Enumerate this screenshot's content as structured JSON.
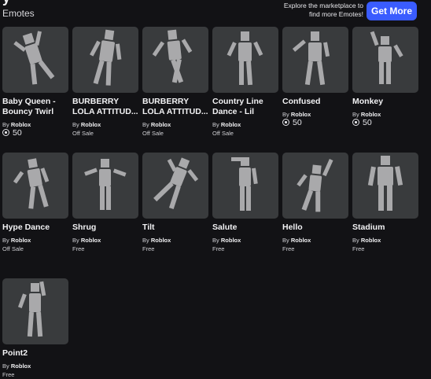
{
  "header": {
    "section_title": "Emotes",
    "promo_text_line1": "Explore the marketplace to",
    "promo_text_line2": "find more Emotes!",
    "get_more_label": "Get More"
  },
  "colors": {
    "accent": "#3a5cff",
    "card_bg": "#393b3d",
    "page_bg": "#121215"
  },
  "emotes": [
    {
      "name_line1": "Baby Queen -",
      "name_line2": "Bouncy Twirl",
      "by": "By",
      "creator": "Roblox",
      "price": "50",
      "price_type": "robux",
      "icon": "robux-icon"
    },
    {
      "name_line1": "BURBERRY",
      "name_line2": "LOLA ATTITUD...",
      "by": "By",
      "creator": "Roblox",
      "price": "Off Sale",
      "price_type": "text"
    },
    {
      "name_line1": "BURBERRY",
      "name_line2": "LOLA ATTITUD...",
      "by": "By",
      "creator": "Roblox",
      "price": "Off Sale",
      "price_type": "text"
    },
    {
      "name_line1": "Country Line",
      "name_line2": "Dance - Lil Nas...",
      "by": "By",
      "creator": "Roblox",
      "price": "Off Sale",
      "price_type": "text"
    },
    {
      "name": "Confused",
      "by": "By",
      "creator": "Roblox",
      "price": "50",
      "price_type": "robux",
      "icon": "robux-icon"
    },
    {
      "name": "Monkey",
      "by": "By",
      "creator": "Roblox",
      "price": "50",
      "price_type": "robux",
      "icon": "robux-icon"
    },
    {
      "name": "Hype Dance",
      "by": "By",
      "creator": "Roblox",
      "price": "Off Sale",
      "price_type": "text"
    },
    {
      "name": "Shrug",
      "by": "By",
      "creator": "Roblox",
      "price": "Free",
      "price_type": "text"
    },
    {
      "name": "Tilt",
      "by": "By",
      "creator": "Roblox",
      "price": "Free",
      "price_type": "text"
    },
    {
      "name": "Salute",
      "by": "By",
      "creator": "Roblox",
      "price": "Free",
      "price_type": "text"
    },
    {
      "name": "Hello",
      "by": "By",
      "creator": "Roblox",
      "price": "Free",
      "price_type": "text"
    },
    {
      "name": "Stadium",
      "by": "By",
      "creator": "Roblox",
      "price": "Free",
      "price_type": "text"
    },
    {
      "name": "Point2",
      "by": "By",
      "creator": "Roblox",
      "price": "Free",
      "price_type": "text"
    }
  ]
}
